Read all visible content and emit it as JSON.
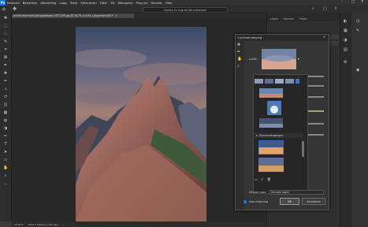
{
  "app": {
    "logo": "Ps"
  },
  "menu": [
    "Bestand",
    "Bewerken",
    "Afbeelding",
    "Laag",
    "Tekst",
    "Selecteren",
    "Filter",
    "3D",
    "Weergave",
    "Plug-ins",
    "Venster",
    "Help"
  ],
  "window_controls": {
    "minimize": "–",
    "maximize": "□",
    "close": "✕"
  },
  "search": {
    "placeholder": "Zoeken en hulp bij het ontwerpen"
  },
  "document": {
    "tab_title": "pexels-eberhard-grossgasteiger-1671196.jpg @ 16,7% (Lucht, Laagmasker/8) *",
    "close": "×"
  },
  "status": {
    "zoom": "16,67%",
    "info": "4000 X 6000 px (300 ppi)",
    "arrow": "›"
  },
  "panels": {
    "tabs": [
      "Lagen",
      "Kanalen",
      "Paden"
    ]
  },
  "tools": [
    {
      "icon": "move-icon",
      "glyph": "✥"
    },
    {
      "icon": "marquee-icon",
      "glyph": "⬚"
    },
    {
      "icon": "lasso-icon",
      "glyph": "◌"
    },
    {
      "icon": "quick-select-icon",
      "glyph": "✎"
    },
    {
      "icon": "crop-icon",
      "glyph": "⌗"
    },
    {
      "icon": "frame-icon",
      "glyph": "⊠"
    },
    {
      "icon": "eyedropper-icon",
      "glyph": "✒"
    },
    {
      "icon": "healing-icon",
      "glyph": "✚"
    },
    {
      "icon": "brush-icon",
      "glyph": "✏"
    },
    {
      "icon": "stamp-icon",
      "glyph": "⊥"
    },
    {
      "icon": "history-brush-icon",
      "glyph": "↺"
    },
    {
      "icon": "eraser-icon",
      "glyph": "◫"
    },
    {
      "icon": "gradient-icon",
      "glyph": "▦"
    },
    {
      "icon": "blur-icon",
      "glyph": "◍"
    },
    {
      "icon": "dodge-icon",
      "glyph": "◑"
    },
    {
      "icon": "pen-icon",
      "glyph": "✑"
    },
    {
      "icon": "type-icon",
      "glyph": "T"
    },
    {
      "icon": "path-select-icon",
      "glyph": "➤"
    },
    {
      "icon": "shape-icon",
      "glyph": "▭"
    },
    {
      "icon": "hand-icon",
      "glyph": "✋"
    },
    {
      "icon": "zoom-icon",
      "glyph": "⌕"
    },
    {
      "icon": "more-icon",
      "glyph": "…"
    }
  ],
  "dialog": {
    "title": "Luchtvervanging",
    "close": "✕",
    "sky_label": "Lucht:",
    "group_label": "Zonsondergangen",
    "output_label": "Uitvoer naar:",
    "output_value": "Nieuwe lagen",
    "preview_label": "Voorvertoning",
    "ok": "OK",
    "cancel": "Annuleren"
  },
  "colors": {
    "accent": "#1473e6",
    "bg": "#3a3a3a",
    "panel": "#2f2f2f"
  }
}
